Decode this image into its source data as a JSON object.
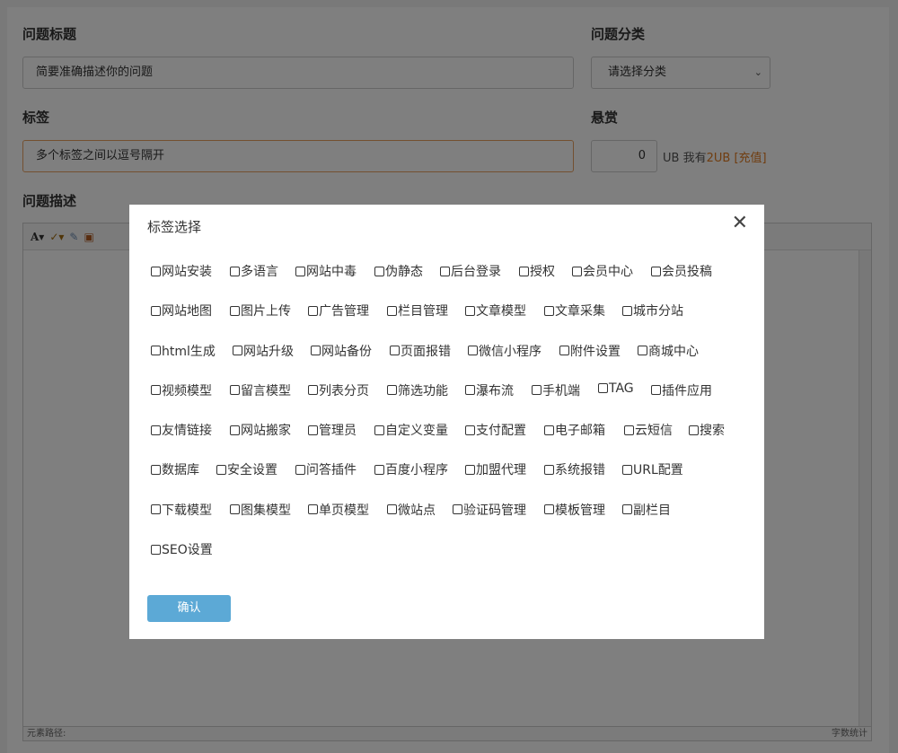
{
  "form": {
    "title_label": "问题标题",
    "title_placeholder": "简要准确描述你的问题",
    "category_label": "问题分类",
    "category_selected": "请选择分类",
    "tags_label": "标签",
    "tags_placeholder": "多个标签之间以逗号隔开",
    "reward_label": "悬赏",
    "reward_value": "0",
    "reward_unit": "UB 我有",
    "reward_have": "2UB",
    "reward_recharge": "[充值]",
    "desc_label": "问题描述",
    "editor_path": "元素路径:",
    "editor_wordcount": "字数统计"
  },
  "modal": {
    "title": "标签选择",
    "close_glyph": "✕",
    "confirm_label": "确认",
    "tag_rows": [
      [
        "网站安装",
        "多语言",
        "网站中毒",
        "伪静态",
        "后台登录",
        "授权",
        "会员中心",
        "会员投稿"
      ],
      [
        "网站地图",
        "图片上传",
        "广告管理",
        "栏目管理",
        "文章模型",
        "文章采集",
        "城市分站"
      ],
      [
        "html生成",
        "网站升级",
        "网站备份",
        "页面报错",
        "微信小程序",
        "附件设置",
        "商城中心"
      ],
      [
        "视频模型",
        "留言模型",
        "列表分页",
        "筛选功能",
        "瀑布流",
        "手机端",
        "TAG",
        "插件应用"
      ],
      [
        "友情链接",
        "网站搬家",
        "管理员",
        "自定义变量",
        "支付配置",
        "电子邮箱",
        "云短信",
        "搜索"
      ],
      [
        "数据库",
        "安全设置",
        "问答插件",
        "百度小程序",
        "加盟代理",
        "系统报错",
        "URL配置"
      ],
      [
        "下载模型",
        "图集模型",
        "单页模型",
        "微站点",
        "验证码管理",
        "模板管理",
        "副栏目"
      ],
      [
        "SEO设置"
      ]
    ]
  },
  "colors": {
    "accent_orange": "#e07b20",
    "button_blue": "#5ca9d6"
  }
}
